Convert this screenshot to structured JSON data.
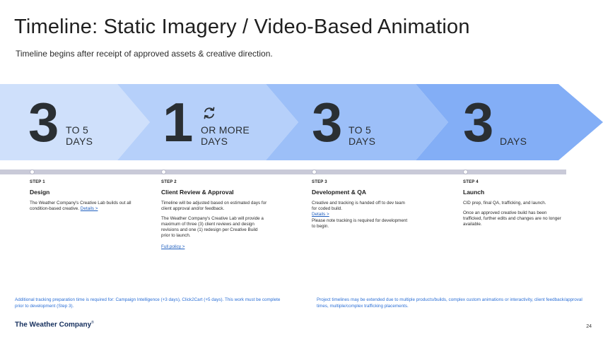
{
  "title": "Timeline: Static Imagery / Video-Based Animation",
  "subtitle": "Timeline begins after receipt of approved assets & creative direction.",
  "colors": {
    "chevron_1": "#cfe0fb",
    "chevron_2": "#b6d0fa",
    "chevron_3": "#9cbff8",
    "chevron_4": "#83aef6",
    "progress_bar": "#c9cad8",
    "link": "#1f5fbf",
    "footnote": "#2b6fd6",
    "brand": "#16305e"
  },
  "phases": [
    {
      "number": "3",
      "unit_line1": "TO 5",
      "unit_line2": "DAYS"
    },
    {
      "number": "1",
      "unit_line1": "OR MORE",
      "unit_line2": "DAYS",
      "icon": "refresh-cycle-icon"
    },
    {
      "number": "3",
      "unit_line1": "TO 5",
      "unit_line2": "DAYS"
    },
    {
      "number": "3",
      "unit_line1": "",
      "unit_line2": "DAYS"
    }
  ],
  "steps": [
    {
      "label": "STEP 1",
      "name": "Design",
      "text1": "The Weather Company's Creative Lab builds out all condition-based creative.",
      "link": "Details >"
    },
    {
      "label": "STEP 2",
      "name": "Client Review & Approval",
      "text1": "Timeline will be adjusted based on estimated days for client approval and/or feedback.",
      "text2": "The Weather Company's Creative Lab will provide a maximum of three (3) client reviews and design revisions and one (1) redesign per Creative Build prior to launch.",
      "link": "Full policy >"
    },
    {
      "label": "STEP 3",
      "name": "Development & QA",
      "text1": "Creative and tracking is handed off to dev team for coded build.",
      "link": "Details >",
      "text2": "Please note tracking is required for development to begin."
    },
    {
      "label": "STEP 4",
      "name": "Launch",
      "text1": "CID prep, final QA, trafficking, and launch.",
      "text2": "Once an approved creative build has been trafficked, further edits and changes are no longer available."
    }
  ],
  "footnotes": {
    "left": "Additional tracking preparation time is required for: Campaign Intelligence (+3 days), Click2Cart (+5 days). This work must be complete prior to development (Step 3).",
    "right": "Project timelines may be extended due to multiple products/builds, complex custom animations or interactivity, client feedback/approval times, multiple/complex trafficking placements."
  },
  "brand": {
    "name": "The Weather Company",
    "mark": "®"
  },
  "page_number": "24"
}
